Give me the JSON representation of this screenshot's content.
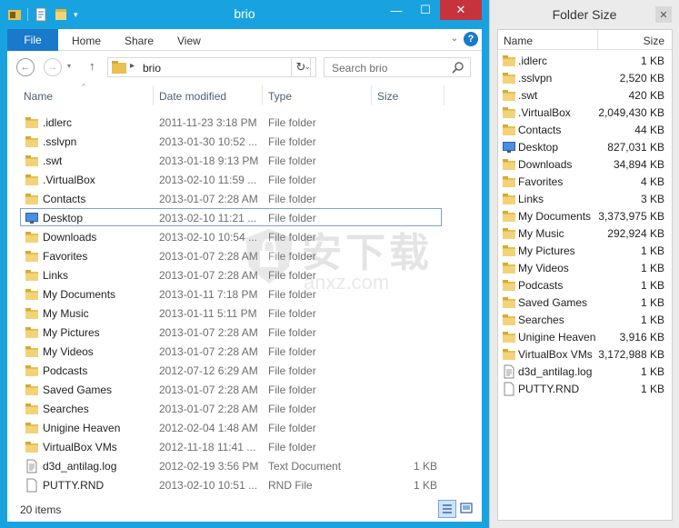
{
  "window": {
    "title": "brio",
    "minimize": "—",
    "maximize": "☐",
    "close": "✕"
  },
  "ribbon": {
    "file": "File",
    "tabs": [
      "Home",
      "Share",
      "View"
    ],
    "help": "?"
  },
  "nav": {
    "back": "←",
    "forward": "→",
    "up": "↑",
    "address": "brio",
    "refresh": "↻",
    "search_placeholder": "Search brio"
  },
  "columns": {
    "name": "Name",
    "date": "Date modified",
    "type": "Type",
    "size": "Size"
  },
  "files": [
    {
      "name": ".idlerc",
      "date": "2011-11-23 3:18 PM",
      "type": "File folder",
      "size": "",
      "icon": "folder"
    },
    {
      "name": ".sslvpn",
      "date": "2013-01-30 10:52 ...",
      "type": "File folder",
      "size": "",
      "icon": "folder"
    },
    {
      "name": ".swt",
      "date": "2013-01-18 9:13 PM",
      "type": "File folder",
      "size": "",
      "icon": "folder"
    },
    {
      "name": ".VirtualBox",
      "date": "2013-02-10 11:59 ...",
      "type": "File folder",
      "size": "",
      "icon": "folder"
    },
    {
      "name": "Contacts",
      "date": "2013-01-07 2:28 AM",
      "type": "File folder",
      "size": "",
      "icon": "folder"
    },
    {
      "name": "Desktop",
      "date": "2013-02-10 11:21 ...",
      "type": "File folder",
      "size": "",
      "icon": "desktop"
    },
    {
      "name": "Downloads",
      "date": "2013-02-10 10:54 ...",
      "type": "File folder",
      "size": "",
      "icon": "folder"
    },
    {
      "name": "Favorites",
      "date": "2013-01-07 2:28 AM",
      "type": "File folder",
      "size": "",
      "icon": "folder"
    },
    {
      "name": "Links",
      "date": "2013-01-07 2:28 AM",
      "type": "File folder",
      "size": "",
      "icon": "folder"
    },
    {
      "name": "My Documents",
      "date": "2013-01-11 7:18 PM",
      "type": "File folder",
      "size": "",
      "icon": "folder"
    },
    {
      "name": "My Music",
      "date": "2013-01-11 5:11 PM",
      "type": "File folder",
      "size": "",
      "icon": "folder"
    },
    {
      "name": "My Pictures",
      "date": "2013-01-07 2:28 AM",
      "type": "File folder",
      "size": "",
      "icon": "folder"
    },
    {
      "name": "My Videos",
      "date": "2013-01-07 2:28 AM",
      "type": "File folder",
      "size": "",
      "icon": "folder"
    },
    {
      "name": "Podcasts",
      "date": "2012-07-12 6:29 AM",
      "type": "File folder",
      "size": "",
      "icon": "folder"
    },
    {
      "name": "Saved Games",
      "date": "2013-01-07 2:28 AM",
      "type": "File folder",
      "size": "",
      "icon": "folder"
    },
    {
      "name": "Searches",
      "date": "2013-01-07 2:28 AM",
      "type": "File folder",
      "size": "",
      "icon": "folder"
    },
    {
      "name": "Unigine Heaven",
      "date": "2012-02-04 1:48 AM",
      "type": "File folder",
      "size": "",
      "icon": "folder"
    },
    {
      "name": "VirtualBox VMs",
      "date": "2012-11-18 11:41 ...",
      "type": "File folder",
      "size": "",
      "icon": "folder"
    },
    {
      "name": "d3d_antilag.log",
      "date": "2012-02-19 3:56 PM",
      "type": "Text Document",
      "size": "1 KB",
      "icon": "textfile"
    },
    {
      "name": "PUTTY.RND",
      "date": "2013-02-10 10:51 ...",
      "type": "RND File",
      "size": "1 KB",
      "icon": "blankfile"
    }
  ],
  "status": {
    "count": "20 items"
  },
  "watermark": {
    "text": "安下载",
    "sub": "anxz.com"
  },
  "folder_size": {
    "title": "Folder Size",
    "close": "✕",
    "col_name": "Name",
    "col_size": "Size",
    "rows": [
      {
        "name": ".idlerc",
        "size": "1 KB",
        "icon": "folder"
      },
      {
        "name": ".sslvpn",
        "size": "2,520 KB",
        "icon": "folder"
      },
      {
        "name": ".swt",
        "size": "420 KB",
        "icon": "folder"
      },
      {
        "name": ".VirtualBox",
        "size": "2,049,430 KB",
        "icon": "folder"
      },
      {
        "name": "Contacts",
        "size": "44 KB",
        "icon": "folder"
      },
      {
        "name": "Desktop",
        "size": "827,031 KB",
        "icon": "desktop"
      },
      {
        "name": "Downloads",
        "size": "34,894 KB",
        "icon": "folder"
      },
      {
        "name": "Favorites",
        "size": "4 KB",
        "icon": "folder"
      },
      {
        "name": "Links",
        "size": "3 KB",
        "icon": "folder"
      },
      {
        "name": "My Documents",
        "size": "3,373,975 KB",
        "icon": "folder"
      },
      {
        "name": "My Music",
        "size": "292,924 KB",
        "icon": "folder"
      },
      {
        "name": "My Pictures",
        "size": "1 KB",
        "icon": "folder"
      },
      {
        "name": "My Videos",
        "size": "1 KB",
        "icon": "folder"
      },
      {
        "name": "Podcasts",
        "size": "1 KB",
        "icon": "folder"
      },
      {
        "name": "Saved Games",
        "size": "1 KB",
        "icon": "folder"
      },
      {
        "name": "Searches",
        "size": "1 KB",
        "icon": "folder"
      },
      {
        "name": "Unigine Heaven",
        "size": "3,916 KB",
        "icon": "folder"
      },
      {
        "name": "VirtualBox VMs",
        "size": "3,172,988 KB",
        "icon": "folder"
      },
      {
        "name": "d3d_antilag.log",
        "size": "1 KB",
        "icon": "textfile"
      },
      {
        "name": "PUTTY.RND",
        "size": "1 KB",
        "icon": "blankfile"
      }
    ]
  },
  "colors": {
    "titlebar": "#18a3e0",
    "file_tab": "#1979ca",
    "close_button": "#c7333d",
    "folder": "#e8c14e"
  }
}
